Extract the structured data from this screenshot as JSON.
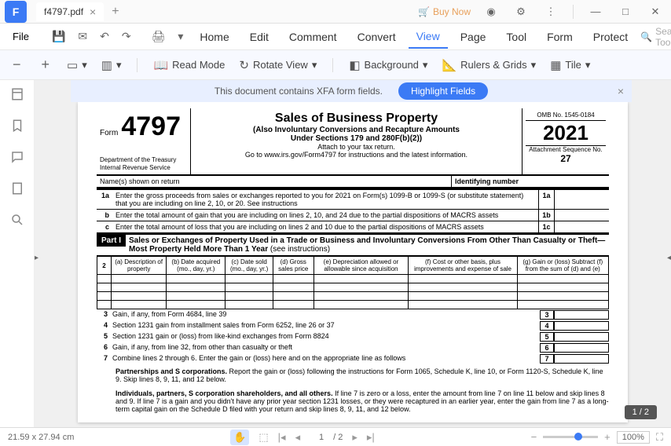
{
  "app": {
    "icon_letter": "F"
  },
  "tab": {
    "title": "f4797.pdf"
  },
  "titlebar": {
    "buy_now": "Buy Now",
    "minimize": "—",
    "maximize": "□",
    "close": "✕"
  },
  "menu": {
    "file": "File",
    "items": [
      "Home",
      "Edit",
      "Comment",
      "Convert",
      "View",
      "Page",
      "Tool",
      "Form",
      "Protect"
    ],
    "active_index": 4,
    "search_placeholder": "Search Tools"
  },
  "toolbar": {
    "read_mode": "Read Mode",
    "rotate_view": "Rotate View",
    "background": "Background",
    "rulers": "Rulers & Grids",
    "tile": "Tile"
  },
  "notice": {
    "text": "This document contains XFA form fields.",
    "button": "Highlight Fields"
  },
  "form": {
    "form_word": "Form",
    "number": "4797",
    "dept1": "Department of the Treasury",
    "dept2": "Internal Revenue Service",
    "title": "Sales of Business Property",
    "subtitle1": "(Also Involuntary Conversions and Recapture Amounts",
    "subtitle2": "Under Sections 179 and 280F(b)(2))",
    "attach": "Attach to your tax return.",
    "goto": "Go to www.irs.gov/Form4797 for instructions and the latest information.",
    "omb": "OMB No. 1545-0184",
    "year": "2021",
    "seq_label": "Attachment\nSequence No.",
    "seq_no": "27",
    "name_label": "Name(s) shown on return",
    "id_label": "Identifying number",
    "line1a_num": "1a",
    "line1a": "Enter the gross proceeds from sales or exchanges reported to you for 2021 on Form(s) 1099-B or 1099-S (or substitute statement) that you are including on line 2, 10, or 20. See instructions",
    "line1b_num": "b",
    "line1b": "Enter the total amount of gain that you are including on lines 2, 10, and 24 due to the partial dispositions of MACRS assets",
    "line1c_num": "c",
    "line1c": "Enter the total amount of loss that you are including on lines 2 and 10 due to the partial dispositions of MACRS assets",
    "box1a": "1a",
    "box1b": "1b",
    "box1c": "1c",
    "part1_label": "Part I",
    "part1_title": "Sales or Exchanges of Property Used in a Trade or Business and Involuntary Conversions From Other Than Casualty or Theft—Most Property Held More Than 1 Year",
    "part1_see": "(see instructions)",
    "col2": "2",
    "cols": {
      "a": "(a) Description of property",
      "b": "(b) Date acquired (mo., day, yr.)",
      "c": "(c) Date sold (mo., day, yr.)",
      "d": "(d) Gross sales price",
      "e": "(e) Depreciation allowed or allowable since acquisition",
      "f": "(f) Cost or other basis, plus improvements and expense of sale",
      "g": "(g) Gain or (loss) Subtract (f) from the sum of (d) and (e)"
    },
    "lines": [
      {
        "n": "3",
        "t": "Gain, if any, from Form 4684, line 39",
        "b": "3"
      },
      {
        "n": "4",
        "t": "Section 1231 gain from installment sales from Form 6252, line 26 or 37",
        "b": "4"
      },
      {
        "n": "5",
        "t": "Section 1231 gain or (loss) from like-kind exchanges from Form 8824",
        "b": "5"
      },
      {
        "n": "6",
        "t": "Gain, if any, from line 32, from other than casualty or theft",
        "b": "6"
      },
      {
        "n": "7",
        "t": "Combine lines 2 through 6. Enter the gain or (loss) here and on the appropriate line as follows",
        "b": "7"
      }
    ],
    "para1_lead": "Partnerships and S corporations.",
    "para1": "Report the gain or (loss) following the instructions for Form 1065, Schedule K, line 10, or Form 1120-S, Schedule K, line 9. Skip lines 8, 9, 11, and 12 below.",
    "para2_lead": "Individuals, partners, S corporation shareholders, and all others.",
    "para2": "If line 7 is zero or a loss, enter the amount from line 7 on line 11 below and skip lines 8 and 9. If line 7 is a gain and you didn't have any prior year section 1231 losses, or they were recaptured in an earlier year, enter the gain from line 7 as a long-term capital gain on the Schedule D filed with your return and skip lines 8, 9, 11, and 12 below."
  },
  "status": {
    "dimensions": "21.59 x 27.94 cm",
    "page_current": "1",
    "page_total": "/ 2",
    "zoom": "100%",
    "badge": "1 / 2"
  }
}
